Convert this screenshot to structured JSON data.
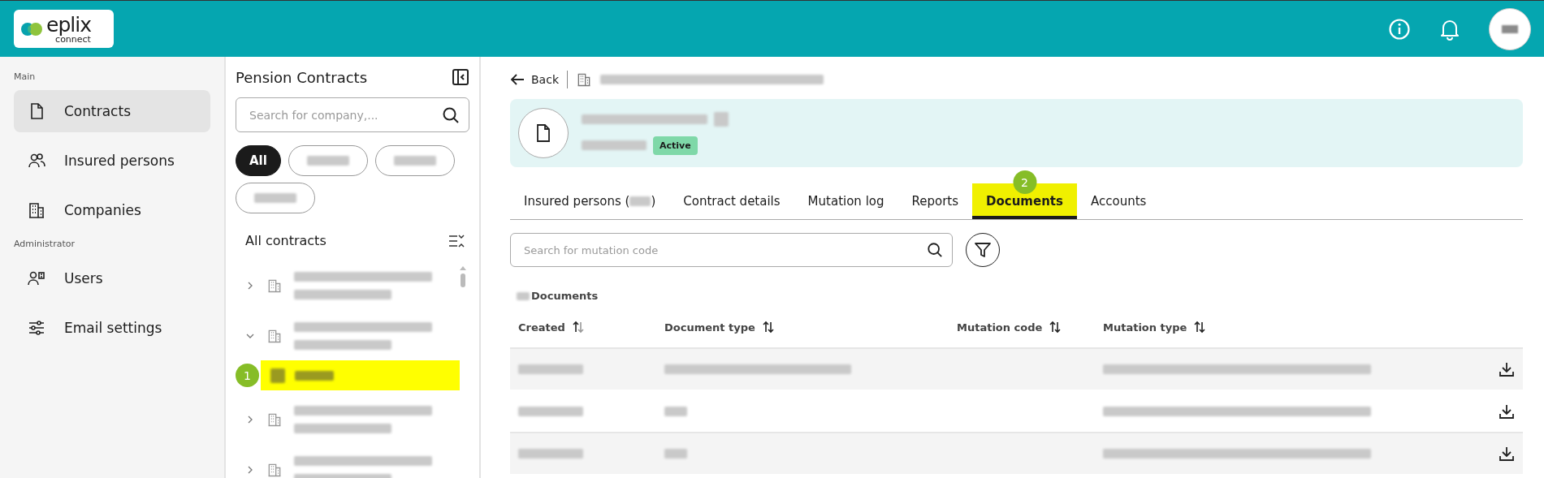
{
  "header": {
    "logo": {
      "word": "eplix",
      "sub": "connect"
    }
  },
  "sidebar": {
    "sections": [
      {
        "title": "Main",
        "items": [
          {
            "label": "Contracts",
            "kind": "document",
            "selected": true
          },
          {
            "label": "Insured persons",
            "kind": "people",
            "selected": false
          },
          {
            "label": "Companies",
            "kind": "building",
            "selected": false
          }
        ]
      },
      {
        "title": "Administrator",
        "items": [
          {
            "label": "Users",
            "kind": "users",
            "selected": false
          },
          {
            "label": "Email settings",
            "kind": "sliders",
            "selected": false
          }
        ]
      }
    ]
  },
  "contracts_panel": {
    "title": "Pension Contracts",
    "search": {
      "placeholder": "Search for company,..."
    },
    "chips": [
      {
        "label": "All",
        "selected": true
      },
      {
        "selected": false
      },
      {
        "selected": false
      },
      {
        "selected": false
      }
    ],
    "list_title": "All contracts",
    "tree": [
      {
        "expanded": false
      },
      {
        "expanded": true,
        "children": [
          {
            "highlighted": true,
            "marker": "1"
          }
        ]
      },
      {
        "expanded": false
      },
      {
        "expanded": false
      }
    ]
  },
  "main": {
    "back": "Back",
    "status_badge": "Active",
    "tabs": [
      {
        "label": "Insured persons (",
        "suffix": ")",
        "selected": false,
        "highlighted": false
      },
      {
        "label": "Contract details",
        "selected": false,
        "highlighted": false
      },
      {
        "label": "Mutation log",
        "selected": false,
        "highlighted": false
      },
      {
        "label": "Reports",
        "selected": false,
        "highlighted": false
      },
      {
        "label": "Documents",
        "selected": true,
        "highlighted": true,
        "marker": "2"
      },
      {
        "label": "Accounts",
        "selected": false,
        "highlighted": false
      }
    ],
    "search": {
      "placeholder": "Search for mutation code"
    },
    "count_label": "Documents",
    "table": {
      "columns": [
        "Created",
        "Document type",
        "Mutation code",
        "Mutation type"
      ],
      "rows": [
        {
          "shaded": true
        },
        {
          "shaded": false
        },
        {
          "shaded": true
        }
      ]
    }
  }
}
